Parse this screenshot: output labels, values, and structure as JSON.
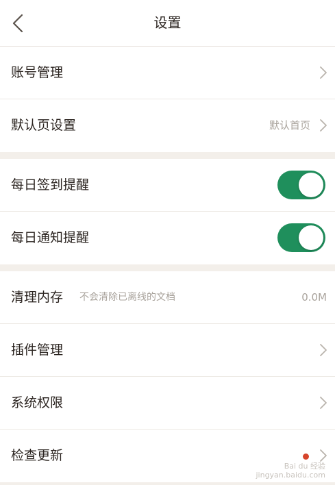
{
  "header": {
    "title": "设置",
    "back_icon": "chevron-left-icon"
  },
  "group1": {
    "items": [
      {
        "label": "账号管理"
      },
      {
        "label": "默认页设置",
        "value": "默认首页"
      }
    ]
  },
  "group2": {
    "items": [
      {
        "label": "每日签到提醒",
        "toggle_on": true
      },
      {
        "label": "每日通知提醒",
        "toggle_on": true
      }
    ]
  },
  "group3": {
    "items": [
      {
        "label": "清理内存",
        "sub": "不会清除已离线的文档",
        "value": "0.0M"
      },
      {
        "label": "插件管理"
      },
      {
        "label": "系统权限"
      },
      {
        "label": "检查更新",
        "has_dot": true
      }
    ]
  },
  "colors": {
    "accent": "#1f8f5c",
    "badge": "#d6452c",
    "background": "#f3efea",
    "text": "#2b2420",
    "muted": "#a9a39c"
  },
  "watermark": {
    "line1": "Bai du 经验",
    "line2": "jingyan.baidu.com"
  }
}
